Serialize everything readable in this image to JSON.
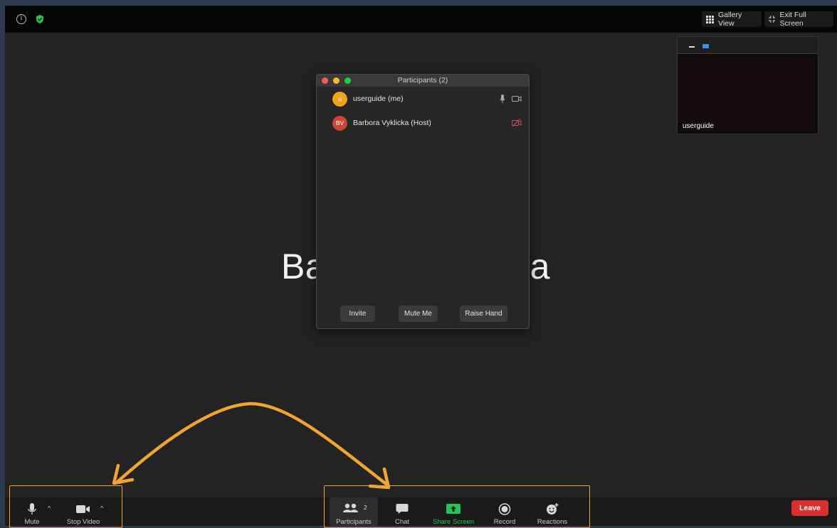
{
  "top_bar": {
    "info_icon": "info-icon",
    "security_icon": "shield-icon",
    "security_color": "#2bc24a",
    "gallery_view_label": "Gallery View",
    "exit_full_screen_label": "Exit Full Screen"
  },
  "main": {
    "speaker_name_left": "Ba",
    "speaker_name_right": "ka"
  },
  "self_view": {
    "name": "userguide"
  },
  "participants_panel": {
    "title": "Participants (2)",
    "participants": [
      {
        "initials": "u",
        "name": "userguide (me)",
        "avatar_color": "#f0a31f",
        "icons": [
          "microphone-icon",
          "video-camera-icon"
        ]
      },
      {
        "initials": "BV",
        "name": "Barbora Vyklicka (Host)",
        "avatar_color": "#c9443a",
        "icons": [
          "video-off-icon"
        ]
      }
    ],
    "buttons": {
      "invite": "Invite",
      "mute_me": "Mute Me",
      "raise_hand": "Raise Hand"
    }
  },
  "toolbar": {
    "mute_label": "Mute",
    "stop_video_label": "Stop Video",
    "participants_label": "Participants",
    "participants_count": "2",
    "chat_label": "Chat",
    "share_screen_label": "Share Screen",
    "share_screen_color": "#23c35a",
    "record_label": "Record",
    "reactions_label": "Reactions",
    "leave_label": "Leave",
    "leave_color": "#d8302e"
  },
  "annotations": {
    "highlight_color": "#f0a431",
    "arrow_color": "#f0a431"
  }
}
